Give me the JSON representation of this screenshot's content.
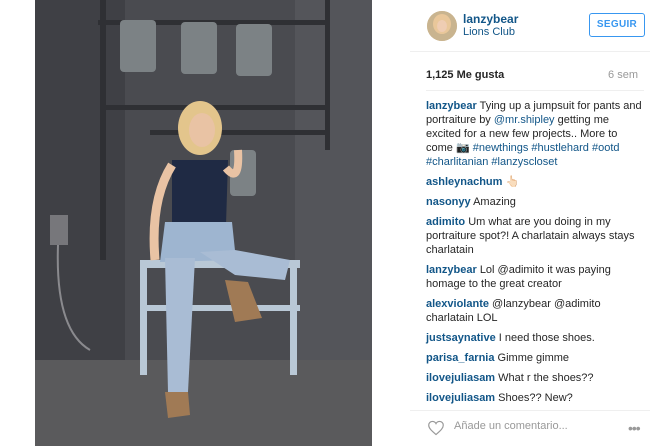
{
  "post": {
    "username": "lanzybear",
    "location": "Lions Club",
    "follow_label": "SEGUIR",
    "likes": "1,125 Me gusta",
    "age": "6 sem"
  },
  "caption": {
    "user": "lanzybear",
    "text1": " Tying up a jumpsuit for pants and portraiture by ",
    "mention": "@mr.shipley",
    "text2": " getting me excited for a new few projects.. More to come ",
    "emoji": "📷",
    "tags": " #newthings #hustlehard #ootd #charlitanian #lanzyscloset"
  },
  "comments": [
    {
      "user": "ashleynachum",
      "text": "👆🏻"
    },
    {
      "user": "nasonyy",
      "text": "Amazing"
    },
    {
      "user": "adimito",
      "text": "Um what are you doing in my portraiture spot?! A charlatain always stays charlatain"
    },
    {
      "user": "lanzybear",
      "text": "Lol @adimito it was paying homage to the great creator"
    },
    {
      "user": "alexviolante",
      "text": "@lanzybear @adimito charlatain LOL"
    },
    {
      "user": "justsaynative",
      "text": "I need those shoes."
    },
    {
      "user": "parisa_farnia",
      "text": "Gimme gimme"
    },
    {
      "user": "ilovejuliasam",
      "text": "What r the shoes??"
    },
    {
      "user": "ilovejuliasam",
      "text": "Shoes?? New?"
    }
  ],
  "footer": {
    "comment_placeholder": "Añade un comentario...",
    "more_icon": "more-dots-icon",
    "like_icon": "heart-icon"
  },
  "colors": {
    "link": "#125688",
    "follow": "#3897f0"
  }
}
